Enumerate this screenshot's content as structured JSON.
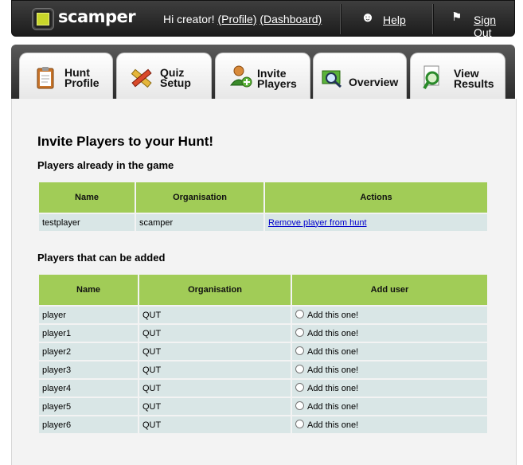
{
  "header": {
    "logo_text": "scamper",
    "greeting": "Hi creator!",
    "profile_link": "(Profile)",
    "dashboard_link": "(Dashboard)",
    "help_link": "Help",
    "sign_out_link": "Sign Out"
  },
  "tabs": [
    {
      "label": "Hunt\nProfile"
    },
    {
      "label": "Quiz\nSetup"
    },
    {
      "label": "Invite\nPlayers"
    },
    {
      "label": "Overview"
    },
    {
      "label": "View\nResults"
    }
  ],
  "main": {
    "title": "Invite Players to your Hunt!",
    "existing_heading": "Players already in the game",
    "existing_columns": [
      "Name",
      "Organisation",
      "Actions"
    ],
    "existing_rows": [
      {
        "name": "testplayer",
        "organisation": "scamper",
        "action": "Remove player from hunt"
      }
    ],
    "add_heading": "Players that can be added",
    "add_columns": [
      "Name",
      "Organisation",
      "Add user"
    ],
    "add_rows": [
      {
        "name": "player",
        "organisation": "QUT",
        "action": "Add this one!"
      },
      {
        "name": "player1",
        "organisation": "QUT",
        "action": "Add this one!"
      },
      {
        "name": "player2",
        "organisation": "QUT",
        "action": "Add this one!"
      },
      {
        "name": "player3",
        "organisation": "QUT",
        "action": "Add this one!"
      },
      {
        "name": "player4",
        "organisation": "QUT",
        "action": "Add this one!"
      },
      {
        "name": "player5",
        "organisation": "QUT",
        "action": "Add this one!"
      },
      {
        "name": "player6",
        "organisation": "QUT",
        "action": "Add this one!"
      }
    ]
  },
  "colors": {
    "header_bg": "#2a2a2a",
    "table_header": "#a1cc57",
    "table_cell": "#d9e6e6",
    "link": "#0000cc"
  }
}
